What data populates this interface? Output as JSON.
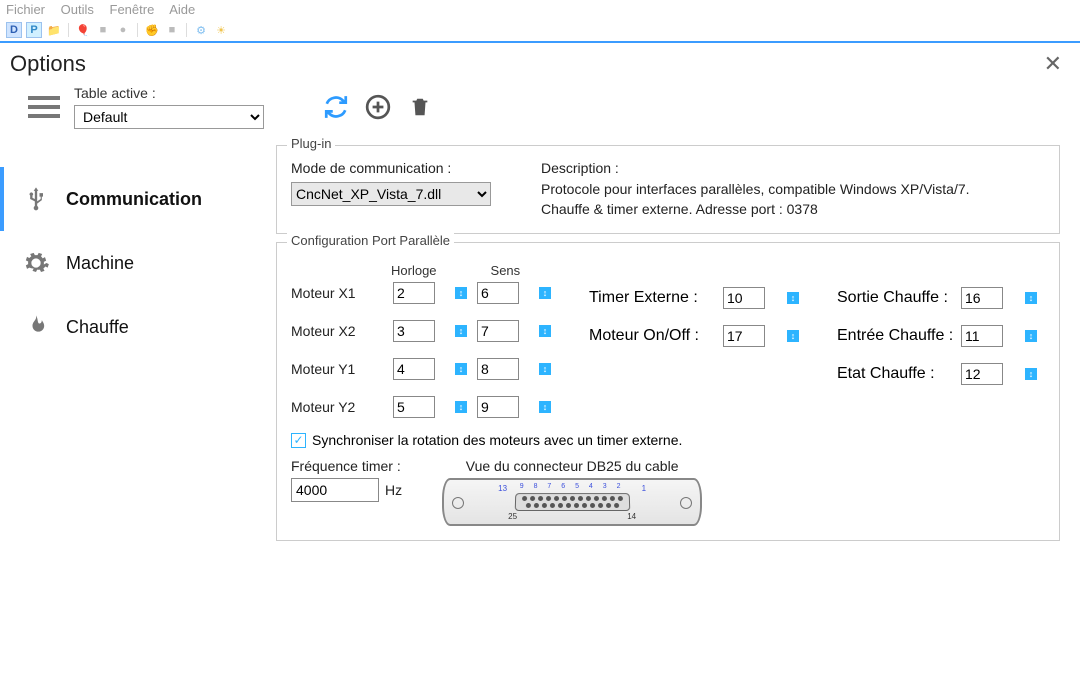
{
  "menu": {
    "file": "Fichier",
    "tools": "Outils",
    "window": "Fenêtre",
    "help": "Aide"
  },
  "window": {
    "title": "Options"
  },
  "table": {
    "label": "Table active :",
    "selected": "Default"
  },
  "sidebar": {
    "communication": "Communication",
    "machine": "Machine",
    "chauffe": "Chauffe"
  },
  "plugin": {
    "group": "Plug-in",
    "mode_label": "Mode de communication :",
    "mode_value": "CncNet_XP_Vista_7.dll",
    "desc_label": "Description :",
    "desc_text": "Protocole pour interfaces parallèles, compatible Windows XP/Vista/7. Chauffe & timer externe. Adresse port : 0378"
  },
  "port": {
    "group": "Configuration Port Parallèle",
    "horloge": "Horloge",
    "sens": "Sens",
    "motors": {
      "x1": {
        "label": "Moteur X1",
        "h": "2",
        "s": "6"
      },
      "x2": {
        "label": "Moteur X2",
        "h": "3",
        "s": "7"
      },
      "y1": {
        "label": "Moteur Y1",
        "h": "4",
        "s": "8"
      },
      "y2": {
        "label": "Moteur Y2",
        "h": "5",
        "s": "9"
      }
    },
    "timer_ext": {
      "label": "Timer Externe :",
      "v": "10"
    },
    "motor_on": {
      "label": "Moteur On/Off :",
      "v": "17"
    },
    "sortie": {
      "label": "Sortie Chauffe :",
      "v": "16"
    },
    "entree": {
      "label": "Entrée Chauffe :",
      "v": "11"
    },
    "etat": {
      "label": "Etat Chauffe :",
      "v": "12"
    },
    "sync": "Synchroniser la rotation des moteurs avec un timer externe.",
    "freq_label": "Fréquence timer :",
    "freq_value": "4000",
    "freq_unit": "Hz",
    "db25_title": "Vue du connecteur DB25 du cable",
    "pins_top": "9 8 7 6 5 4 3 2",
    "pin13": "13",
    "pin1": "1",
    "pin25": "25",
    "pin14": "14"
  }
}
